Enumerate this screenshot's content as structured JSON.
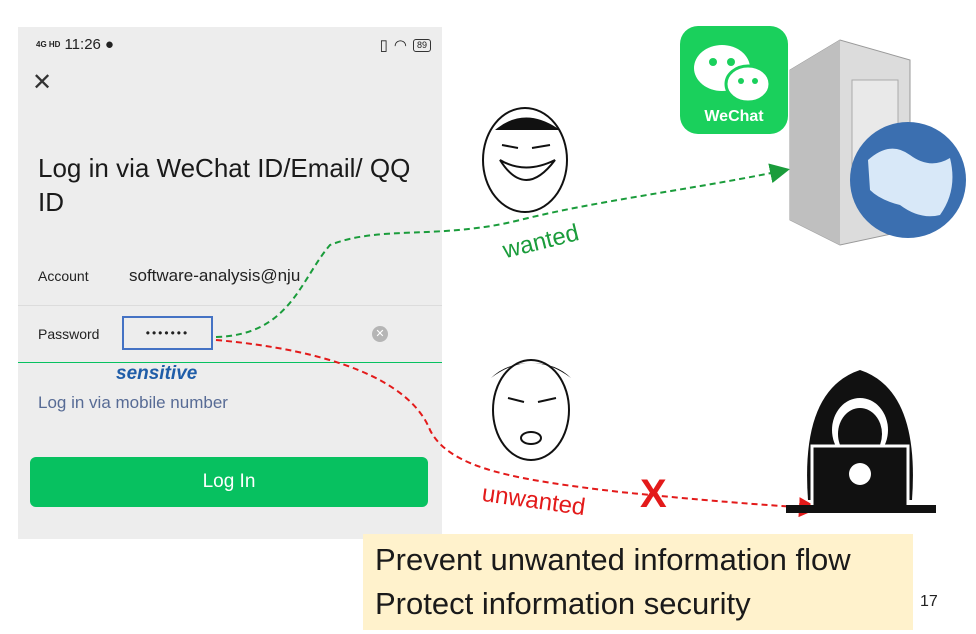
{
  "status_bar": {
    "network": "4G HD",
    "time": "11:26",
    "battery": "89"
  },
  "login": {
    "close_icon": "close-icon",
    "title": "Log in via WeChat ID/Email/ QQ ID",
    "account_label": "Account",
    "account_value": "software-analysis@nju",
    "password_label": "Password",
    "password_value": "•••••••",
    "clear_icon": "clear-icon",
    "alt_login_link": "Log in via mobile number",
    "login_button": "Log In"
  },
  "annotations": {
    "sensitive": "sensitive",
    "wanted": "wanted",
    "unwanted": "unwanted",
    "blocked_mark": "X"
  },
  "logo": {
    "name": "WeChat"
  },
  "callout": {
    "line1": "Prevent unwanted information flow",
    "line2": "Protect information security"
  },
  "page_number": "17",
  "colors": {
    "green": "#07c160",
    "flow_green": "#1a9c3b",
    "flow_red": "#e31a1a",
    "highlight": "#fff2cc",
    "link": "#576b95",
    "sensitive_blue": "#1f5da8"
  }
}
